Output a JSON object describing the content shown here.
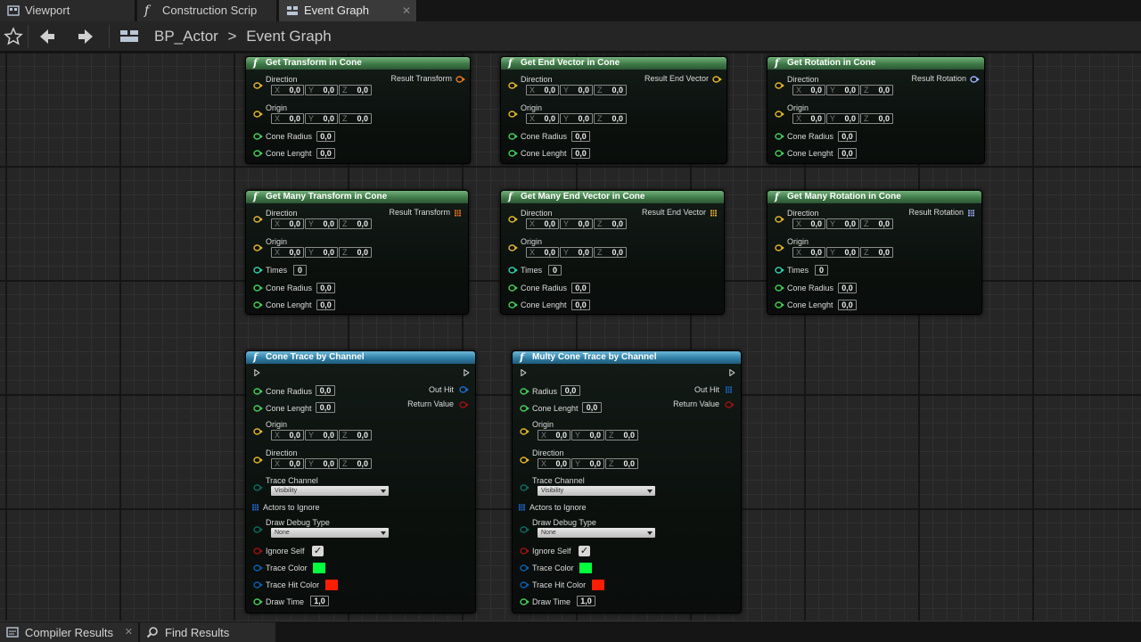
{
  "tabs": [
    {
      "label": "Viewport",
      "icon": "viewport-icon"
    },
    {
      "label": "Construction Scrip",
      "icon": "function-icon"
    },
    {
      "label": "Event Graph",
      "icon": "event-graph-icon"
    }
  ],
  "breadcrumb": {
    "blueprint": "BP_Actor",
    "separator": ">",
    "graph": "Event Graph"
  },
  "nodes": {
    "get_transform": {
      "title": "Get Transform in Cone",
      "direction_label": "Direction",
      "origin_label": "Origin",
      "direction": {
        "x": "0,0",
        "y": "0,0",
        "z": "0,0"
      },
      "origin": {
        "x": "0,0",
        "y": "0,0",
        "z": "0,0"
      },
      "cone_radius_label": "Cone Radius",
      "cone_radius": "0,0",
      "cone_length_label": "Cone Lenght",
      "cone_length": "0,0",
      "output_label": "Result Transform"
    },
    "get_end_vector": {
      "title": "Get End Vector in Cone",
      "direction_label": "Direction",
      "origin_label": "Origin",
      "direction": {
        "x": "0,0",
        "y": "0,0",
        "z": "0,0"
      },
      "origin": {
        "x": "0,0",
        "y": "0,0",
        "z": "0,0"
      },
      "cone_radius_label": "Cone Radius",
      "cone_radius": "0,0",
      "cone_length_label": "Cone Lenght",
      "cone_length": "0,0",
      "output_label": "Result End Vector"
    },
    "get_rotation": {
      "title": "Get Rotation in Cone",
      "direction_label": "Direction",
      "origin_label": "Origin",
      "direction": {
        "x": "0,0",
        "y": "0,0",
        "z": "0,0"
      },
      "origin": {
        "x": "0,0",
        "y": "0,0",
        "z": "0,0"
      },
      "cone_radius_label": "Cone Radius",
      "cone_radius": "0,0",
      "cone_length_label": "Cone Lenght",
      "cone_length": "0,0",
      "output_label": "Result Rotation"
    },
    "get_many_transform": {
      "title": "Get Many Transform in Cone",
      "direction_label": "Direction",
      "origin_label": "Origin",
      "direction": {
        "x": "0,0",
        "y": "0,0",
        "z": "0,0"
      },
      "origin": {
        "x": "0,0",
        "y": "0,0",
        "z": "0,0"
      },
      "times_label": "Times",
      "times": "0",
      "cone_radius_label": "Cone Radius",
      "cone_radius": "0,0",
      "cone_length_label": "Cone Lenght",
      "cone_length": "0,0",
      "output_label": "Result Transform"
    },
    "get_many_end_vector": {
      "title": "Get Many End Vector in Cone",
      "direction_label": "Direction",
      "origin_label": "Origin",
      "direction": {
        "x": "0,0",
        "y": "0,0",
        "z": "0,0"
      },
      "origin": {
        "x": "0,0",
        "y": "0,0",
        "z": "0,0"
      },
      "times_label": "Times",
      "times": "0",
      "cone_radius_label": "Cone Radius",
      "cone_radius": "0,0",
      "cone_length_label": "Cone Lenght",
      "cone_length": "0,0",
      "output_label": "Result End Vector"
    },
    "get_many_rotation": {
      "title": "Get Many Rotation in Cone",
      "direction_label": "Direction",
      "origin_label": "Origin",
      "direction": {
        "x": "0,0",
        "y": "0,0",
        "z": "0,0"
      },
      "origin": {
        "x": "0,0",
        "y": "0,0",
        "z": "0,0"
      },
      "times_label": "Times",
      "times": "0",
      "cone_radius_label": "Cone Radius",
      "cone_radius": "0,0",
      "cone_length_label": "Cone Lenght",
      "cone_length": "0,0",
      "output_label": "Result Rotation"
    },
    "cone_trace": {
      "title": "Cone Trace by Channel",
      "cone_radius_label": "Cone Radius",
      "cone_radius": "0,0",
      "cone_length_label": "Cone Lenght",
      "cone_length": "0,0",
      "origin_label": "Origin",
      "origin": {
        "x": "0,0",
        "y": "0,0",
        "z": "0,0"
      },
      "direction_label": "Direction",
      "direction": {
        "x": "0,0",
        "y": "0,0",
        "z": "0,0"
      },
      "trace_channel_label": "Trace Channel",
      "trace_channel": "Visibility",
      "actors_to_ignore_label": "Actors to Ignore",
      "draw_debug_type_label": "Draw Debug Type",
      "draw_debug_type": "None",
      "ignore_self_label": "Ignore Self",
      "ignore_self_checked": true,
      "trace_color_label": "Trace Color",
      "trace_color": "#00ff3c",
      "trace_hit_color_label": "Trace Hit Color",
      "trace_hit_color": "#ff1e00",
      "draw_time_label": "Draw Time",
      "draw_time": "1,0",
      "out_hit_label": "Out Hit",
      "return_value_label": "Return Value"
    },
    "multy_cone_trace": {
      "title": "Multy Cone Trace by Channel",
      "radius_label": "Radius",
      "radius": "0,0",
      "cone_length_label": "Cone Lenght",
      "cone_length": "0,0",
      "origin_label": "Origin",
      "origin": {
        "x": "0,0",
        "y": "0,0",
        "z": "0,0"
      },
      "direction_label": "Direction",
      "direction": {
        "x": "0,0",
        "y": "0,0",
        "z": "0,0"
      },
      "trace_channel_label": "Trace Channel",
      "trace_channel": "Visibility",
      "actors_to_ignore_label": "Actors to Ignore",
      "draw_debug_type_label": "Draw Debug Type",
      "draw_debug_type": "None",
      "ignore_self_label": "Ignore Self",
      "ignore_self_checked": true,
      "trace_color_label": "Trace Color",
      "trace_color": "#00ff3c",
      "trace_hit_color_label": "Trace Hit Color",
      "trace_hit_color": "#ff1e00",
      "draw_time_label": "Draw Time",
      "draw_time": "1,0",
      "out_hit_label": "Out Hit",
      "return_value_label": "Return Value"
    }
  },
  "axis_labels": {
    "x": "X",
    "y": "Y",
    "z": "Z"
  },
  "bottom_tabs": [
    {
      "label": "Compiler Results",
      "icon": "compiler-results-icon"
    },
    {
      "label": "Find Results",
      "icon": "find-results-icon"
    }
  ],
  "colors": {
    "vector_pin": "#e8b830",
    "transform_pin": "#f07a1e",
    "rotator_pin": "#9fb2ff",
    "float_pin": "#45d05a",
    "int_pin": "#2fd4b0",
    "struct_pin": "#1a6fd0",
    "bool_pin": "#a01010",
    "enum_pin": "#0d6b5e",
    "linear_color_pin": "#0a5fb0",
    "node_header_pure": "#3f7b48",
    "node_header_callable": "#2f7fa6"
  }
}
